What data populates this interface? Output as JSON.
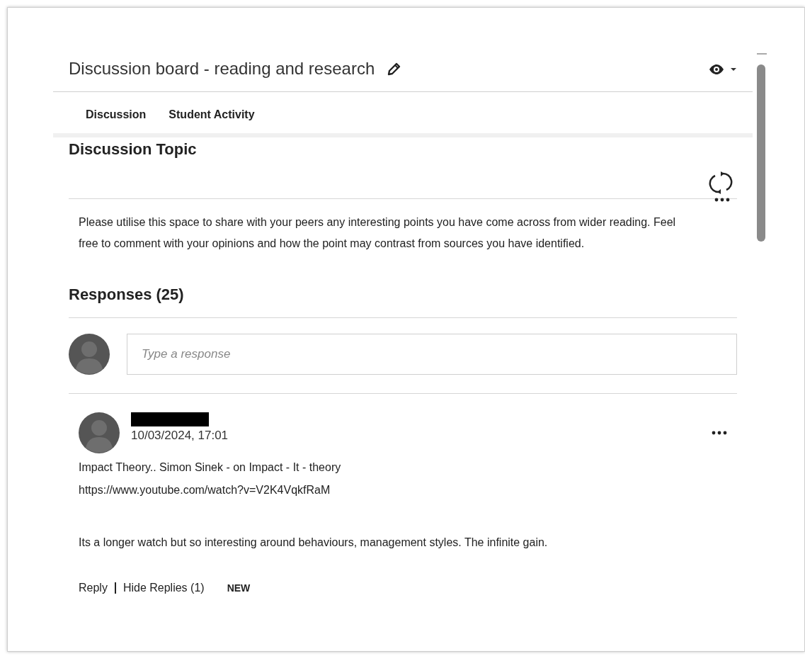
{
  "header": {
    "title": "Discussion board - reading and research"
  },
  "tabs": [
    {
      "label": "Discussion"
    },
    {
      "label": "Student Activity"
    }
  ],
  "topic": {
    "heading": "Discussion Topic",
    "body": "Please utilise this space to share with your peers any interesting points you have come across from wider reading. Feel free to comment with your opinions and how the point may contrast from sources you have identified."
  },
  "responses": {
    "heading": "Responses (25)",
    "placeholder": "Type a response"
  },
  "posts": [
    {
      "date": "10/03/2024, 17:01",
      "title": "Impact Theory.. Simon Sinek - on Impact - It - theory",
      "link": "https://www.youtube.com/watch?v=V2K4VqkfRaM",
      "body": "Its a longer watch but so interesting around behaviours, management styles. The infinite gain.",
      "actions": [
        "Reply",
        "Hide Replies (1)"
      ],
      "badge": "NEW"
    }
  ]
}
